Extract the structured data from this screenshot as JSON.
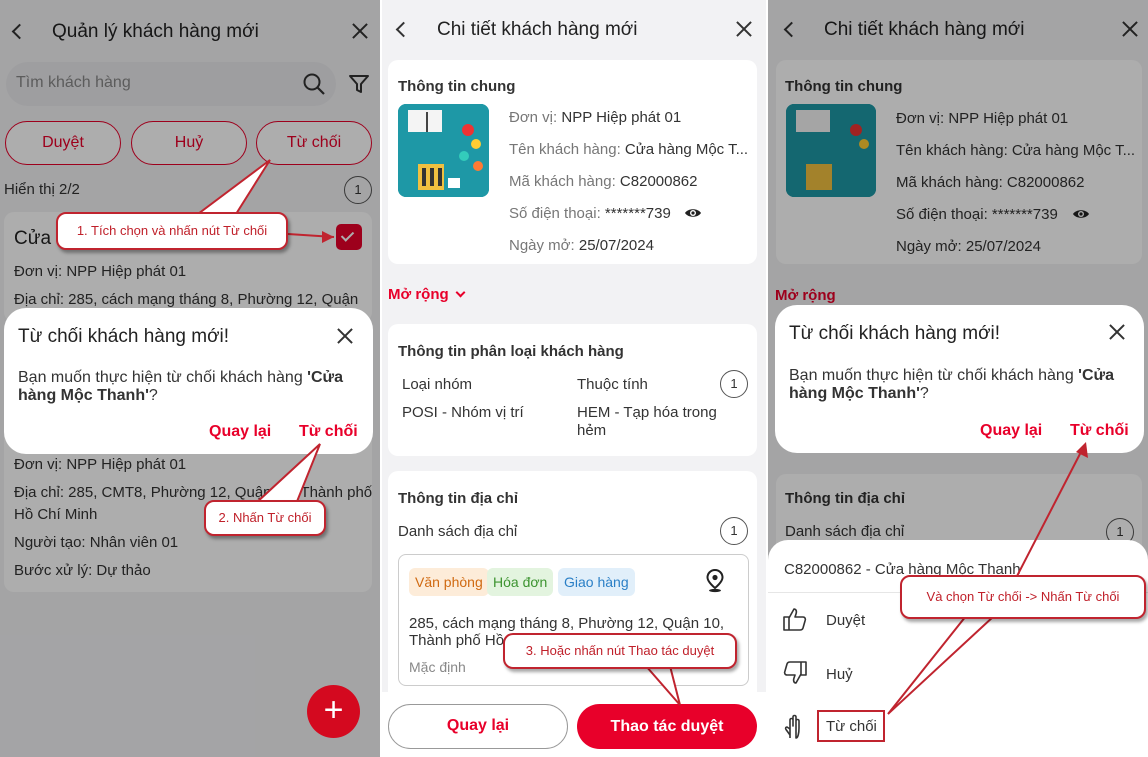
{
  "panel1": {
    "title": "Quản lý khách hàng mới",
    "search_placeholder": "Tìm khách hàng",
    "filters": [
      "Duyệt",
      "Huỷ",
      "Từ chối"
    ],
    "count_label": "Hiển thị 2/2",
    "page_badge": "1",
    "card1": {
      "name": "Cửa h",
      "unit": "Đơn vị: NPP Hiệp phát 01",
      "address": "Địa chỉ: 285, cách mạng tháng 8, Phường 12, Quận"
    },
    "card2": {
      "unit": "Đơn vị: NPP Hiệp phát 01",
      "address_l1": "Địa chỉ: 285, CMT8, Phường 12, Quận 10, Thành phố",
      "address_l2": "Hồ Chí Minh",
      "creator": "Người tạo: Nhân viên 01",
      "step": "Bước xử lý: Dự thảo"
    },
    "dialog": {
      "title": "Từ chối khách hàng mới!",
      "body_prefix": "Bạn muốn thực hiện từ chối khách hàng ",
      "body_name": "'Cửa hàng Mộc Thanh'",
      "body_suffix": "?",
      "back": "Quay lại",
      "reject": "Từ chối"
    },
    "fab": "+",
    "callout1": "1. Tích chọn và nhấn nút Từ chối",
    "callout2": "2. Nhấn Từ chối"
  },
  "panel2": {
    "title": "Chi tiết khách hàng mới",
    "general": {
      "heading": "Thông tin chung",
      "unit_label": "Đơn vị:",
      "unit_value": "NPP Hiệp phát 01",
      "name_label": "Tên khách hàng:",
      "name_value": "Cửa hàng Mộc T...",
      "code_label": "Mã khách hàng:",
      "code_value": "C82000862",
      "phone_label": "Số điện thoại:",
      "phone_value": "*******739",
      "date_label": "Ngày mở:",
      "date_value": "25/07/2024"
    },
    "expand": "Mở rộng",
    "classify": {
      "heading": "Thông tin phân loại khách hàng",
      "group_label": "Loại nhóm",
      "attr_label": "Thuộc tính",
      "badge": "1",
      "group_value": "POSI - Nhóm vị trí",
      "attr_value": "HEM - Tạp hóa trong hẻm"
    },
    "address": {
      "heading": "Thông tin địa chỉ",
      "list_label": "Danh sách địa chỉ",
      "badge": "1",
      "chips": [
        "Văn phòng",
        "Hóa đơn",
        "Giao hàng"
      ],
      "line1": "285, cách mạng tháng 8, Phường 12, Quận 10,",
      "line2": "Thành phố Hồ",
      "default": "Mặc định"
    },
    "back_button": "Quay lại",
    "action_button": "Thao tác duyệt",
    "callout3": "3. Hoặc nhấn nút Thao tác duyệt"
  },
  "panel3": {
    "title": "Chi tiết khách hàng mới",
    "general": {
      "heading": "Thông tin chung",
      "unit": "Đơn vị: NPP Hiệp phát 01",
      "name": "Tên khách hàng: Cửa hàng Mộc T...",
      "code": "Mã khách hàng: C82000862",
      "phone": "Số điện thoại: *******739",
      "date": "Ngày mở: 25/07/2024"
    },
    "expand": "Mở rộng",
    "addr_heading": "Thông tin địa chỉ",
    "addr_list": "Danh sách địa chỉ",
    "addr_badge": "1",
    "dialog": {
      "title": "Từ chối khách hàng mới!",
      "body_prefix": "Bạn muốn thực hiện từ chối khách hàng ",
      "body_name": "'Cửa hàng Mộc Thanh'",
      "body_suffix": "?",
      "back": "Quay lại",
      "reject": "Từ chối"
    },
    "sheet": {
      "title": "C82000862 - Cửa hàng Mộc Thanh",
      "items": [
        "Duyệt",
        "Huỷ",
        "Từ chối"
      ]
    },
    "callout4": "Và chọn Từ chối -> Nhấn Từ chối"
  },
  "colors": {
    "accent": "#e8002a",
    "callout_border": "#c0242f"
  }
}
